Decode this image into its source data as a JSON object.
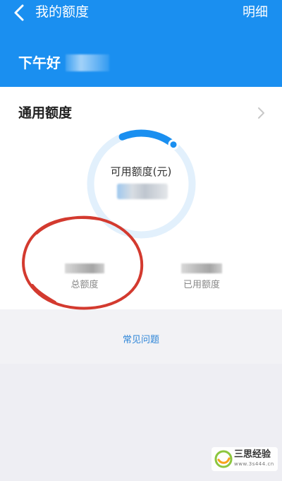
{
  "header": {
    "title": "我的额度",
    "detail_label": "明细",
    "greeting": "下午好"
  },
  "card": {
    "title": "通用额度",
    "gauge": {
      "label": "可用额度(元)",
      "available_fraction": 0.17
    },
    "stats": [
      {
        "label": "总额度"
      },
      {
        "label": "已用额度"
      }
    ]
  },
  "faq_link": "常见问题",
  "watermark": {
    "name": "三思经验",
    "site": "www.3s444.cn"
  },
  "colors": {
    "header_bg": "#1a8ff0",
    "ring_track": "#e2f0fc",
    "ring_progress": "#1a8ff0",
    "annotation": "#d33a2f",
    "link": "#2f86d8"
  }
}
